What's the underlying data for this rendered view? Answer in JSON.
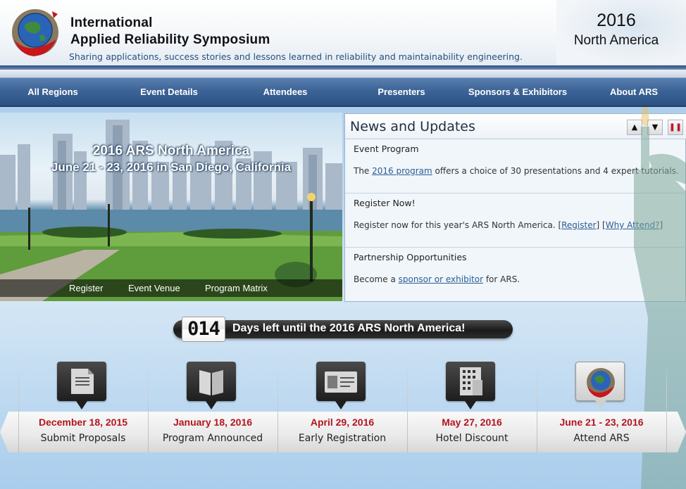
{
  "header": {
    "title_line1": "International",
    "title_line2": "Applied Reliability Symposium",
    "tagline": "Sharing applications, success stories and lessons learned in reliability and maintainability engineering.",
    "year": "2016",
    "region": "North America",
    "logo_icon": "ars-globe-logo-icon"
  },
  "nav": {
    "items": [
      {
        "label": "All Regions"
      },
      {
        "label": "Event Details"
      },
      {
        "label": "Attendees"
      },
      {
        "label": "Presenters"
      },
      {
        "label": "Sponsors & Exhibitors"
      },
      {
        "label": "About ARS"
      }
    ]
  },
  "hero": {
    "title": "2016 ARS North America",
    "subtitle": "June 21 - 23, 2016 in San Diego, California",
    "links": [
      {
        "label": "Register"
      },
      {
        "label": "Event Venue"
      },
      {
        "label": "Program Matrix"
      }
    ]
  },
  "news": {
    "title": "News and Updates",
    "controls": {
      "up_icon": "arrow-up-icon",
      "down_icon": "arrow-down-icon",
      "pause_icon": "pause-icon",
      "up_glyph": "▲",
      "down_glyph": "▼",
      "pause_glyph": "❚❚"
    },
    "items": [
      {
        "title": "Event Program",
        "body_before": "The ",
        "link": "2016 program",
        "body_after": " offers a choice of 30 presentations and 4 expert tutorials."
      },
      {
        "title": "Register Now!",
        "body_before": "Register now for this year's ARS North America. [",
        "link": "Register",
        "body_middle": "] [",
        "link2": "Why Attend?",
        "body_after": "]"
      },
      {
        "title": "Partnership Opportunities",
        "body_before": "Become a ",
        "link": "sponsor or exhibitor",
        "body_after": " for ARS."
      }
    ]
  },
  "countdown": {
    "days": "014",
    "text": "Days left until the 2016 ARS North America!"
  },
  "timeline": {
    "date_color": "#b4141e",
    "milestones": [
      {
        "date": "December 18, 2015",
        "label": "Submit Proposals",
        "icon": "document-icon"
      },
      {
        "date": "January 18, 2016",
        "label": "Program Announced",
        "icon": "booklet-icon"
      },
      {
        "date": "April 29, 2016",
        "label": "Early Registration",
        "icon": "id-card-icon"
      },
      {
        "date": "May 27, 2016",
        "label": "Hotel Discount",
        "icon": "hotel-building-icon"
      },
      {
        "date": "June 21 - 23, 2016",
        "label": "Attend ARS",
        "icon": "ars-globe-icon"
      }
    ]
  }
}
